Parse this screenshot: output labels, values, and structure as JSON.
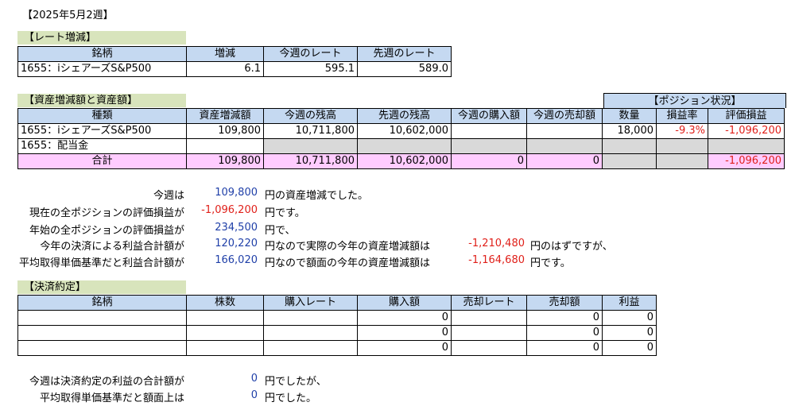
{
  "report_title": "【2025年5月2週】",
  "rate_section": {
    "title": "【レート増減】",
    "headers": [
      "銘柄",
      "増減",
      "今週のレート",
      "先週のレート"
    ],
    "row": {
      "name": "1655：iシェアーズS&P500",
      "change": "6.1",
      "this_week": "595.1",
      "last_week": "589.0"
    }
  },
  "assets_section": {
    "title": "【資産増減額と資産額】",
    "position_title": "【ポジション状況】",
    "headers": [
      "種類",
      "資産増減額",
      "今週の残高",
      "先週の残高",
      "今週の購入額",
      "今週の売却額"
    ],
    "position_headers": [
      "数量",
      "損益率",
      "評価損益"
    ],
    "rows": [
      {
        "type": "1655：iシェアーズS&P500",
        "change": "109,800",
        "this_balance": "10,711,800",
        "last_balance": "10,602,000",
        "buy": "",
        "sell": "",
        "qty": "18,000",
        "rate": "-9.3%",
        "pl": "-1,096,200"
      },
      {
        "type": "1655：配当金",
        "change": "",
        "this_balance": "",
        "last_balance": "",
        "buy": "",
        "sell": "",
        "qty": "",
        "rate": "",
        "pl": ""
      }
    ],
    "total": {
      "type": "合計",
      "change": "109,800",
      "this_balance": "10,711,800",
      "last_balance": "10,602,000",
      "buy": "0",
      "sell": "0",
      "pl": "-1,096,200"
    }
  },
  "summary": {
    "l1_label": "今週は",
    "l1_value": "109,800",
    "l1_suffix": "円の資産増減でした。",
    "l2_label": "現在の全ポジションの評価損益が",
    "l2_value": "-1,096,200",
    "l2_suffix": "円です。",
    "l3_label": "年始の全ポジションの評価損益が",
    "l3_value": "234,500",
    "l3_suffix": "円で、",
    "l4_label": "今年の決済による利益合計額が",
    "l4_value": "120,220",
    "l4_mid": "円なので実際の今年の資産増減額は",
    "l4_value2": "-1,210,480",
    "l4_suffix": "円のはずですが、",
    "l5_label": "平均取得単価基準だと利益合計額が",
    "l5_value": "166,020",
    "l5_mid": "円なので額面の今年の資産増減額は",
    "l5_value2": "-1,164,680",
    "l5_suffix": "円です。"
  },
  "settlement_section": {
    "title": "【決済約定】",
    "headers": [
      "銘柄",
      "株数",
      "購入レート",
      "購入額",
      "売却レート",
      "売却額",
      "利益"
    ],
    "rows": [
      {
        "name": "",
        "shares": "",
        "buy_rate": "",
        "buy_amount": "0",
        "sell_rate": "",
        "sell_amount": "0",
        "profit": "0"
      },
      {
        "name": "",
        "shares": "",
        "buy_rate": "",
        "buy_amount": "0",
        "sell_rate": "",
        "sell_amount": "0",
        "profit": "0"
      },
      {
        "name": "",
        "shares": "",
        "buy_rate": "",
        "buy_amount": "0",
        "sell_rate": "",
        "sell_amount": "0",
        "profit": "0"
      }
    ]
  },
  "footer": {
    "f1_label": "今週は決済約定の利益の合計額が",
    "f1_value": "0",
    "f1_suffix": "円でしたが、",
    "f2_label": "平均取得単価基準だと額面上は",
    "f2_value": "0",
    "f2_suffix": "円でした。"
  },
  "colors": {
    "header_blue": "#c5d9f1",
    "title_green": "#d8e4bc",
    "total_pink": "#ffccff",
    "gray": "#d9d9d9",
    "negative_red": "#e0201a",
    "value_blue": "#1f3fa8"
  }
}
